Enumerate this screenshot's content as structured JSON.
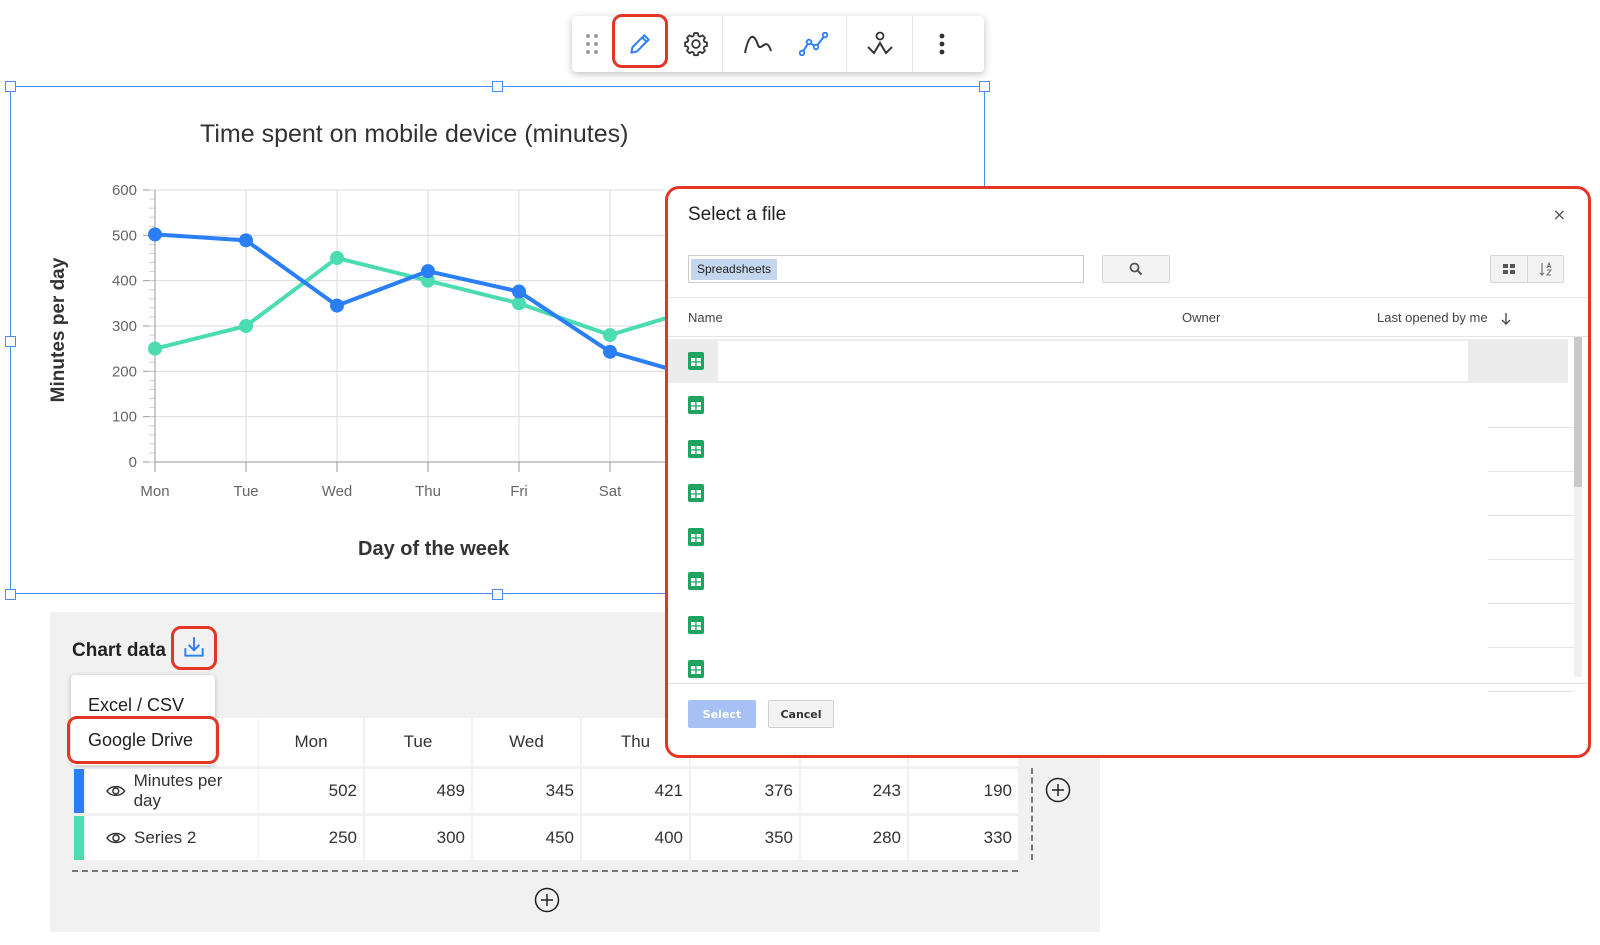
{
  "toolbar": {
    "icons": [
      "drag-handle-icon",
      "pencil-icon",
      "gear-icon",
      "curve-smooth-icon",
      "line-points-icon",
      "trend-icon",
      "more-vert-icon"
    ]
  },
  "chart_data": {
    "type": "line",
    "title": "Time spent on mobile device (minutes)",
    "xlabel": "Day of the week",
    "ylabel": "Minutes per day",
    "categories": [
      "Mon",
      "Tue",
      "Wed",
      "Thu",
      "Fri",
      "Sat"
    ],
    "ylim": [
      0,
      600
    ],
    "yticks": [
      "0",
      "100",
      "200",
      "300",
      "400",
      "500",
      "600"
    ],
    "grid": true,
    "series": [
      {
        "name": "Minutes per day",
        "color": "#2b7ff6",
        "values": [
          502,
          489,
          345,
          421,
          376,
          243
        ]
      },
      {
        "name": "Series 2",
        "color": "#4cdcb2",
        "values": [
          250,
          300,
          450,
          400,
          350,
          280
        ]
      }
    ]
  },
  "panel": {
    "title": "Chart data",
    "menu": [
      "Excel / CSV",
      "Google Drive"
    ],
    "columns": [
      "Mon",
      "Tue",
      "Wed",
      "Thu"
    ],
    "rows": [
      {
        "name": "Minutes per day",
        "color": "#2b7ff6",
        "values": [
          "502",
          "489",
          "345",
          "421",
          "376",
          "243",
          "190"
        ]
      },
      {
        "name": "Series 2",
        "color": "#4cdcb2",
        "values": [
          "250",
          "300",
          "450",
          "400",
          "350",
          "280",
          "330"
        ]
      }
    ]
  },
  "dialog": {
    "title": "Select a file",
    "close": "×",
    "search_chip": "Spreadsheets",
    "col_name": "Name",
    "col_owner": "Owner",
    "col_last_opened": "Last opened by me",
    "select_label": "Select",
    "cancel_label": "Cancel"
  }
}
